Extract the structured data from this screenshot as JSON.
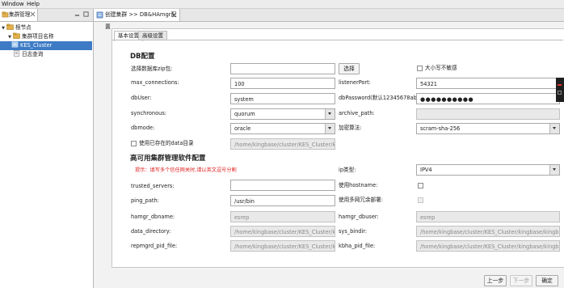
{
  "menubar": {
    "window": "Window",
    "help": "Help"
  },
  "left_panel": {
    "tab_label": "集群管理",
    "tree": [
      {
        "label": "根节点",
        "level": 0,
        "expanded": true
      },
      {
        "label": "集群项目名称",
        "level": 1,
        "expanded": true
      },
      {
        "label": "KES_Cluster",
        "level": 2,
        "selected": true
      },
      {
        "label": "日志查询",
        "level": 1
      }
    ]
  },
  "editor": {
    "tab_title": "创建集群 >> DB&HAmgr配置",
    "subtabs": [
      "基本设置",
      "高级设置"
    ],
    "db_section": {
      "title": "DB配置",
      "zip_label": "选择数据库zip包:",
      "zip_value": "",
      "browse_button": "选择",
      "case_insensitive_label": "大小写不敏感",
      "max_connections_label": "max_connections:",
      "max_connections_value": "100",
      "listen_port_label": "listenerPort:",
      "listen_port_value": "54321",
      "db_user_label": "dbUser:",
      "db_user_value": "system",
      "db_password_label": "dbPassword(默认12345678ab):",
      "db_password_value": "●●●●●●●●●●",
      "synchronous_label": "synchronous:",
      "synchronous_value": "quorum",
      "archive_path_label": "archive_path:",
      "archive_path_value": "",
      "dbmode_label": "dbmode:",
      "dbmode_value": "oracle",
      "encrypt_label": "加密算法:",
      "encrypt_value": "scram-sha-256",
      "use_existing_data_label": "使用已存在的data目录",
      "data_dir_value": "/home/kingbase/cluster/KES_Cluster/kin"
    },
    "ha_section": {
      "title": "高可用集群管理软件配置",
      "hint": "提示：填写多个信任网关时,请以英文逗号分割",
      "ip_type_label": "ip类型:",
      "ip_type_value": "IPV4",
      "trusted_servers_label": "trusted_servers:",
      "trusted_servers_value": "",
      "use_hostname_label": "使用hostname:",
      "ping_path_label": "ping_path:",
      "ping_path_value": "/usr/bin",
      "use_multi_nic_label": "使用多网冗余部署:",
      "hamgr_dbname_label": "hamgr_dbname:",
      "hamgr_dbname_value": "esrep",
      "hamgr_dbuser_label": "hamgr_dbuser:",
      "hamgr_dbuser_value": "esrep",
      "data_directory_label": "data_directory:",
      "data_directory_value": "/home/kingbase/cluster/KES_Cluster/kin",
      "sys_bindir_label": "sys_bindir:",
      "sys_bindir_value": "/home/kingbase/cluster/KES_Cluster/kingbase/kingbase",
      "repmgrd_pid_label": "repmgrd_pid_file:",
      "repmgrd_pid_value": "/home/kingbase/cluster/KES_Cluster/kin",
      "kbha_pid_label": "kbha_pid_file:",
      "kbha_pid_value": "/home/kingbase/cluster/KES_Cluster/kingbase/kingbase"
    },
    "footer": {
      "prev": "上一步",
      "next": "下一步",
      "ok": "确定"
    }
  },
  "colors": {
    "selection": "#3d7bc5",
    "warning": "#e02020",
    "disabled_field": "#e9e9e9"
  }
}
